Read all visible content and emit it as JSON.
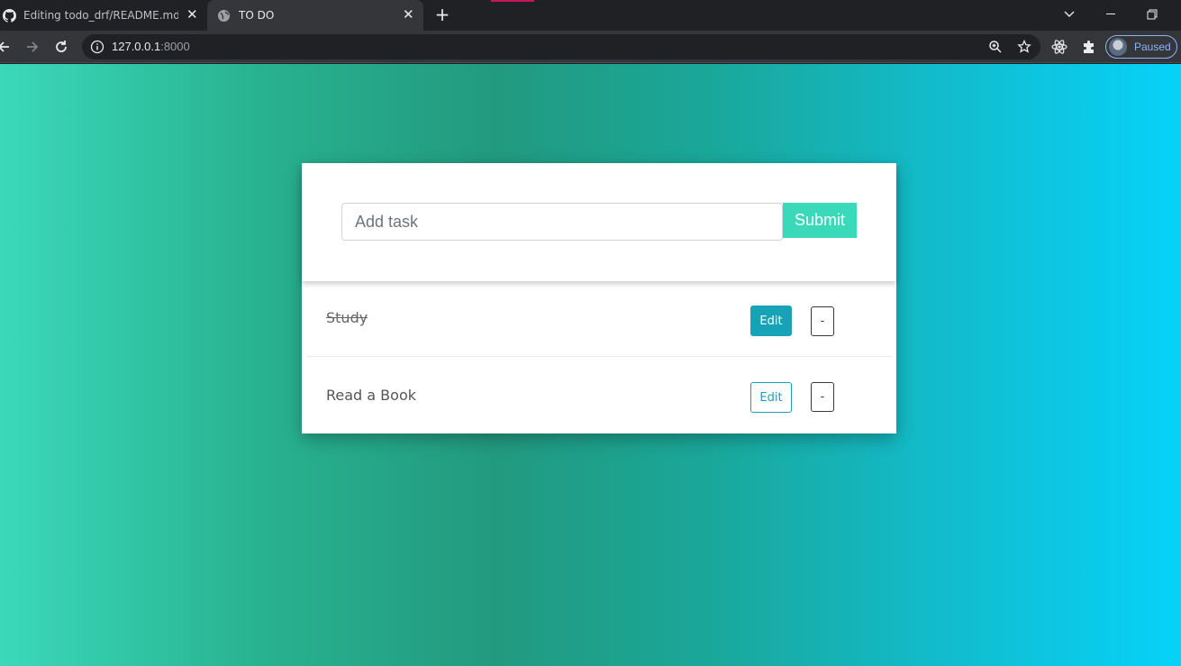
{
  "browser": {
    "tabs": [
      {
        "title": "Editing todo_drf/README.md at ",
        "favicon": "github-icon",
        "active": false
      },
      {
        "title": "TO DO",
        "favicon": "globe-icon",
        "active": true
      }
    ],
    "address": {
      "host": "127.0.0.1",
      "port": ":8000"
    },
    "profile_label": "Paused",
    "colors": {
      "frame": "#202124",
      "toolbar": "#35363a",
      "accent": "#8ab4f8"
    }
  },
  "todo": {
    "input_placeholder": "Add task",
    "submit_label": "Submit",
    "tasks": [
      {
        "title": "Study",
        "completed": true,
        "edit_label": "Edit",
        "delete_label": "-"
      },
      {
        "title": "Read a Book",
        "completed": false,
        "edit_label": "Edit",
        "delete_label": "-"
      }
    ],
    "colors": {
      "submit": "#3ad9ba",
      "edit": "#17a2b8",
      "gradient_start": "#3ad9ba",
      "gradient_end": "#06d2f9"
    }
  }
}
